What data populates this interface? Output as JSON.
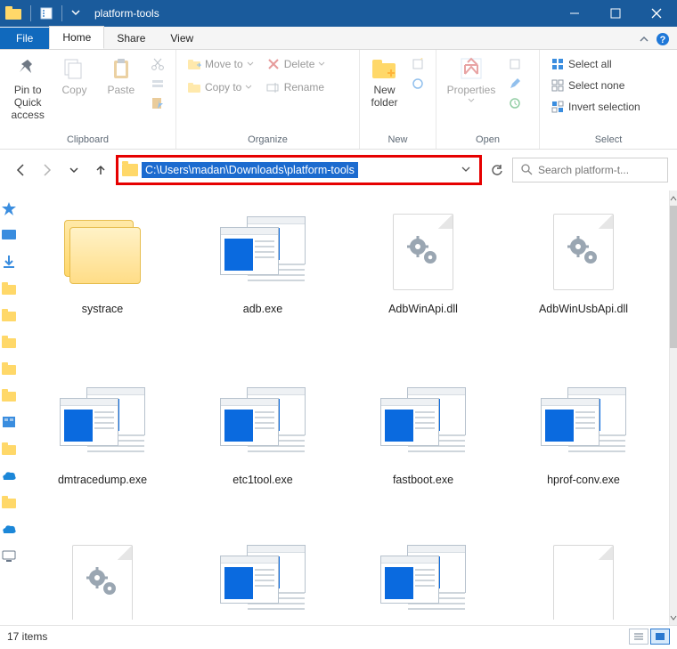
{
  "title": "platform-tools",
  "tabs": {
    "file": "File",
    "home": "Home",
    "share": "Share",
    "view": "View"
  },
  "ribbon": {
    "clipboard": {
      "label": "Clipboard",
      "pin": "Pin to Quick access",
      "copy": "Copy",
      "paste": "Paste"
    },
    "organize": {
      "label": "Organize",
      "move": "Move to",
      "copy": "Copy to",
      "delete": "Delete",
      "rename": "Rename"
    },
    "new": {
      "label": "New",
      "newfolder": "New folder"
    },
    "open": {
      "label": "Open",
      "properties": "Properties"
    },
    "select": {
      "label": "Select",
      "all": "Select all",
      "none": "Select none",
      "invert": "Invert selection"
    }
  },
  "address": "C:\\Users\\madan\\Downloads\\platform-tools",
  "search_placeholder": "Search platform-t...",
  "files": [
    {
      "name": "systrace",
      "type": "folder"
    },
    {
      "name": "adb.exe",
      "type": "exe"
    },
    {
      "name": "AdbWinApi.dll",
      "type": "dll"
    },
    {
      "name": "AdbWinUsbApi.dll",
      "type": "dll"
    },
    {
      "name": "dmtracedump.exe",
      "type": "exe"
    },
    {
      "name": "etc1tool.exe",
      "type": "exe"
    },
    {
      "name": "fastboot.exe",
      "type": "exe"
    },
    {
      "name": "hprof-conv.exe",
      "type": "exe"
    },
    {
      "name": "",
      "type": "dll_partial"
    },
    {
      "name": "",
      "type": "exe_partial"
    },
    {
      "name": "",
      "type": "exe_partial"
    },
    {
      "name": "",
      "type": "blank_partial"
    }
  ],
  "status": "17 items"
}
